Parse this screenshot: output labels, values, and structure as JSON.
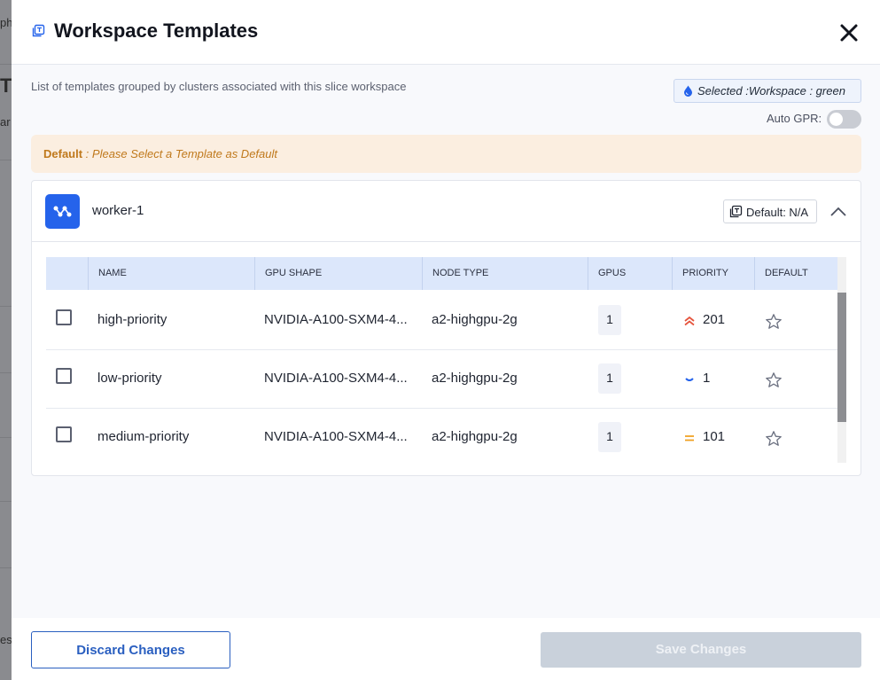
{
  "background": {
    "fragments": [
      "ph",
      "T",
      "ar",
      "es"
    ]
  },
  "header": {
    "title": "Workspace Templates"
  },
  "description": "List of templates grouped by clusters associated with this slice workspace",
  "selected_workspace": {
    "label": "Selected :Workspace : green"
  },
  "auto_gpr": {
    "label": "Auto GPR:",
    "enabled": false
  },
  "default_banner": {
    "label": "Default",
    "separator": " : ",
    "message": "Please Select a Template as Default"
  },
  "cluster": {
    "name": "worker-1",
    "default_chip": "Default: N/A",
    "table": {
      "columns": [
        "NAME",
        "GPU SHAPE",
        "NODE TYPE",
        "GPUS",
        "PRIORITY",
        "DEFAULT"
      ],
      "rows": [
        {
          "name": "high-priority",
          "gpu_shape": "NVIDIA-A100-SXM4-4...",
          "node_type": "a2-highgpu-2g",
          "gpus": "1",
          "priority": "201",
          "priority_icon": "double-chevron-up-icon",
          "checked": false
        },
        {
          "name": "low-priority",
          "gpu_shape": "NVIDIA-A100-SXM4-4...",
          "node_type": "a2-highgpu-2g",
          "gpus": "1",
          "priority": "1",
          "priority_icon": "chevron-down-icon",
          "checked": false
        },
        {
          "name": "medium-priority",
          "gpu_shape": "NVIDIA-A100-SXM4-4...",
          "node_type": "a2-highgpu-2g",
          "gpus": "1",
          "priority": "101",
          "priority_icon": "equals-icon",
          "checked": false
        }
      ]
    }
  },
  "footer": {
    "discard_label": "Discard Changes",
    "save_label": "Save Changes"
  },
  "colors": {
    "accent": "#2563eb",
    "priority_high": "#e5533c",
    "priority_low": "#2563eb",
    "priority_medium": "#f0a020",
    "banner_text": "#c0791c"
  }
}
